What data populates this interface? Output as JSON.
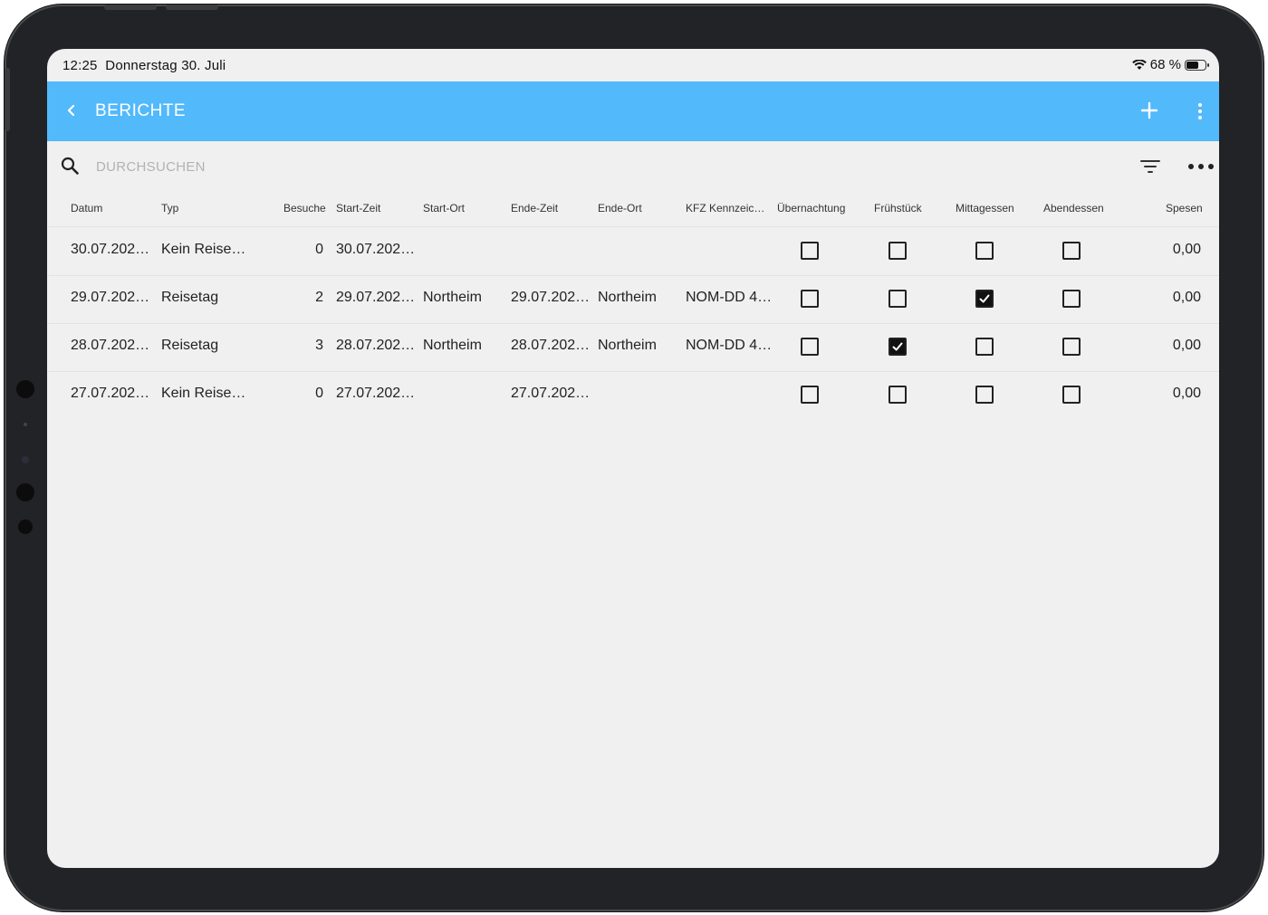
{
  "status": {
    "time": "12:25",
    "date": "Donnerstag 30. Juli",
    "battery_text": "68 %",
    "battery_level": 0.68
  },
  "appbar": {
    "title": "BERICHTE",
    "back_icon": "chevron-left-icon",
    "add_icon": "plus-icon",
    "menu_icon": "kebab-icon",
    "color": "#52b9fb"
  },
  "search": {
    "placeholder": "DURCHSUCHEN",
    "value": ""
  },
  "table": {
    "columns": [
      "Datum",
      "Typ",
      "Besuche",
      "Start-Zeit",
      "Start-Ort",
      "Ende-Zeit",
      "Ende-Ort",
      "KFZ Kennzeic…",
      "Übernachtung",
      "Frühstück",
      "Mittagessen",
      "Abendessen",
      "Spesen"
    ],
    "rows": [
      {
        "datum": "30.07.202…",
        "typ": "Kein Reise…",
        "besuche": "0",
        "start_zeit": "30.07.202…",
        "start_ort": "",
        "ende_zeit": "",
        "ende_ort": "",
        "kfz": "",
        "uebernachtung": false,
        "fruehstueck": false,
        "mittagessen": false,
        "abendessen": false,
        "spesen": "0,00"
      },
      {
        "datum": "29.07.202…",
        "typ": "Reisetag",
        "besuche": "2",
        "start_zeit": "29.07.202…",
        "start_ort": "Northeim",
        "ende_zeit": "29.07.202…",
        "ende_ort": "Northeim",
        "kfz": "NOM-DD 4…",
        "uebernachtung": false,
        "fruehstueck": false,
        "mittagessen": true,
        "abendessen": false,
        "spesen": "0,00"
      },
      {
        "datum": "28.07.202…",
        "typ": "Reisetag",
        "besuche": "3",
        "start_zeit": "28.07.202…",
        "start_ort": "Northeim",
        "ende_zeit": "28.07.202…",
        "ende_ort": "Northeim",
        "kfz": "NOM-DD 4…",
        "uebernachtung": false,
        "fruehstueck": true,
        "mittagessen": false,
        "abendessen": false,
        "spesen": "0,00"
      },
      {
        "datum": "27.07.202…",
        "typ": "Kein Reise…",
        "besuche": "0",
        "start_zeit": "27.07.202…",
        "start_ort": "",
        "ende_zeit": "27.07.202…",
        "ende_ort": "",
        "kfz": "",
        "uebernachtung": false,
        "fruehstueck": false,
        "mittagessen": false,
        "abendessen": false,
        "spesen": "0,00"
      }
    ]
  }
}
